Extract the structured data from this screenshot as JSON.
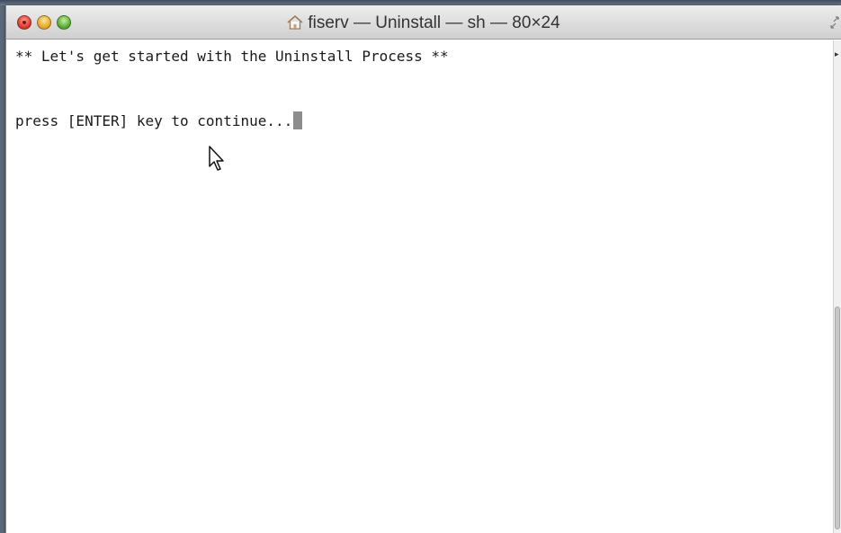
{
  "window": {
    "title": "fiserv — Uninstall — sh — 80×24",
    "title_icon": "home-icon"
  },
  "terminal": {
    "lines": [
      "** Let's get started with the Uninstall Process **",
      "",
      "",
      "press [ENTER] key to continue..."
    ]
  },
  "colors": {
    "close": "#d8322a",
    "minimize": "#e0a21c",
    "zoom": "#4fa42a",
    "background": "#ffffff",
    "text": "#1a1a1a"
  }
}
